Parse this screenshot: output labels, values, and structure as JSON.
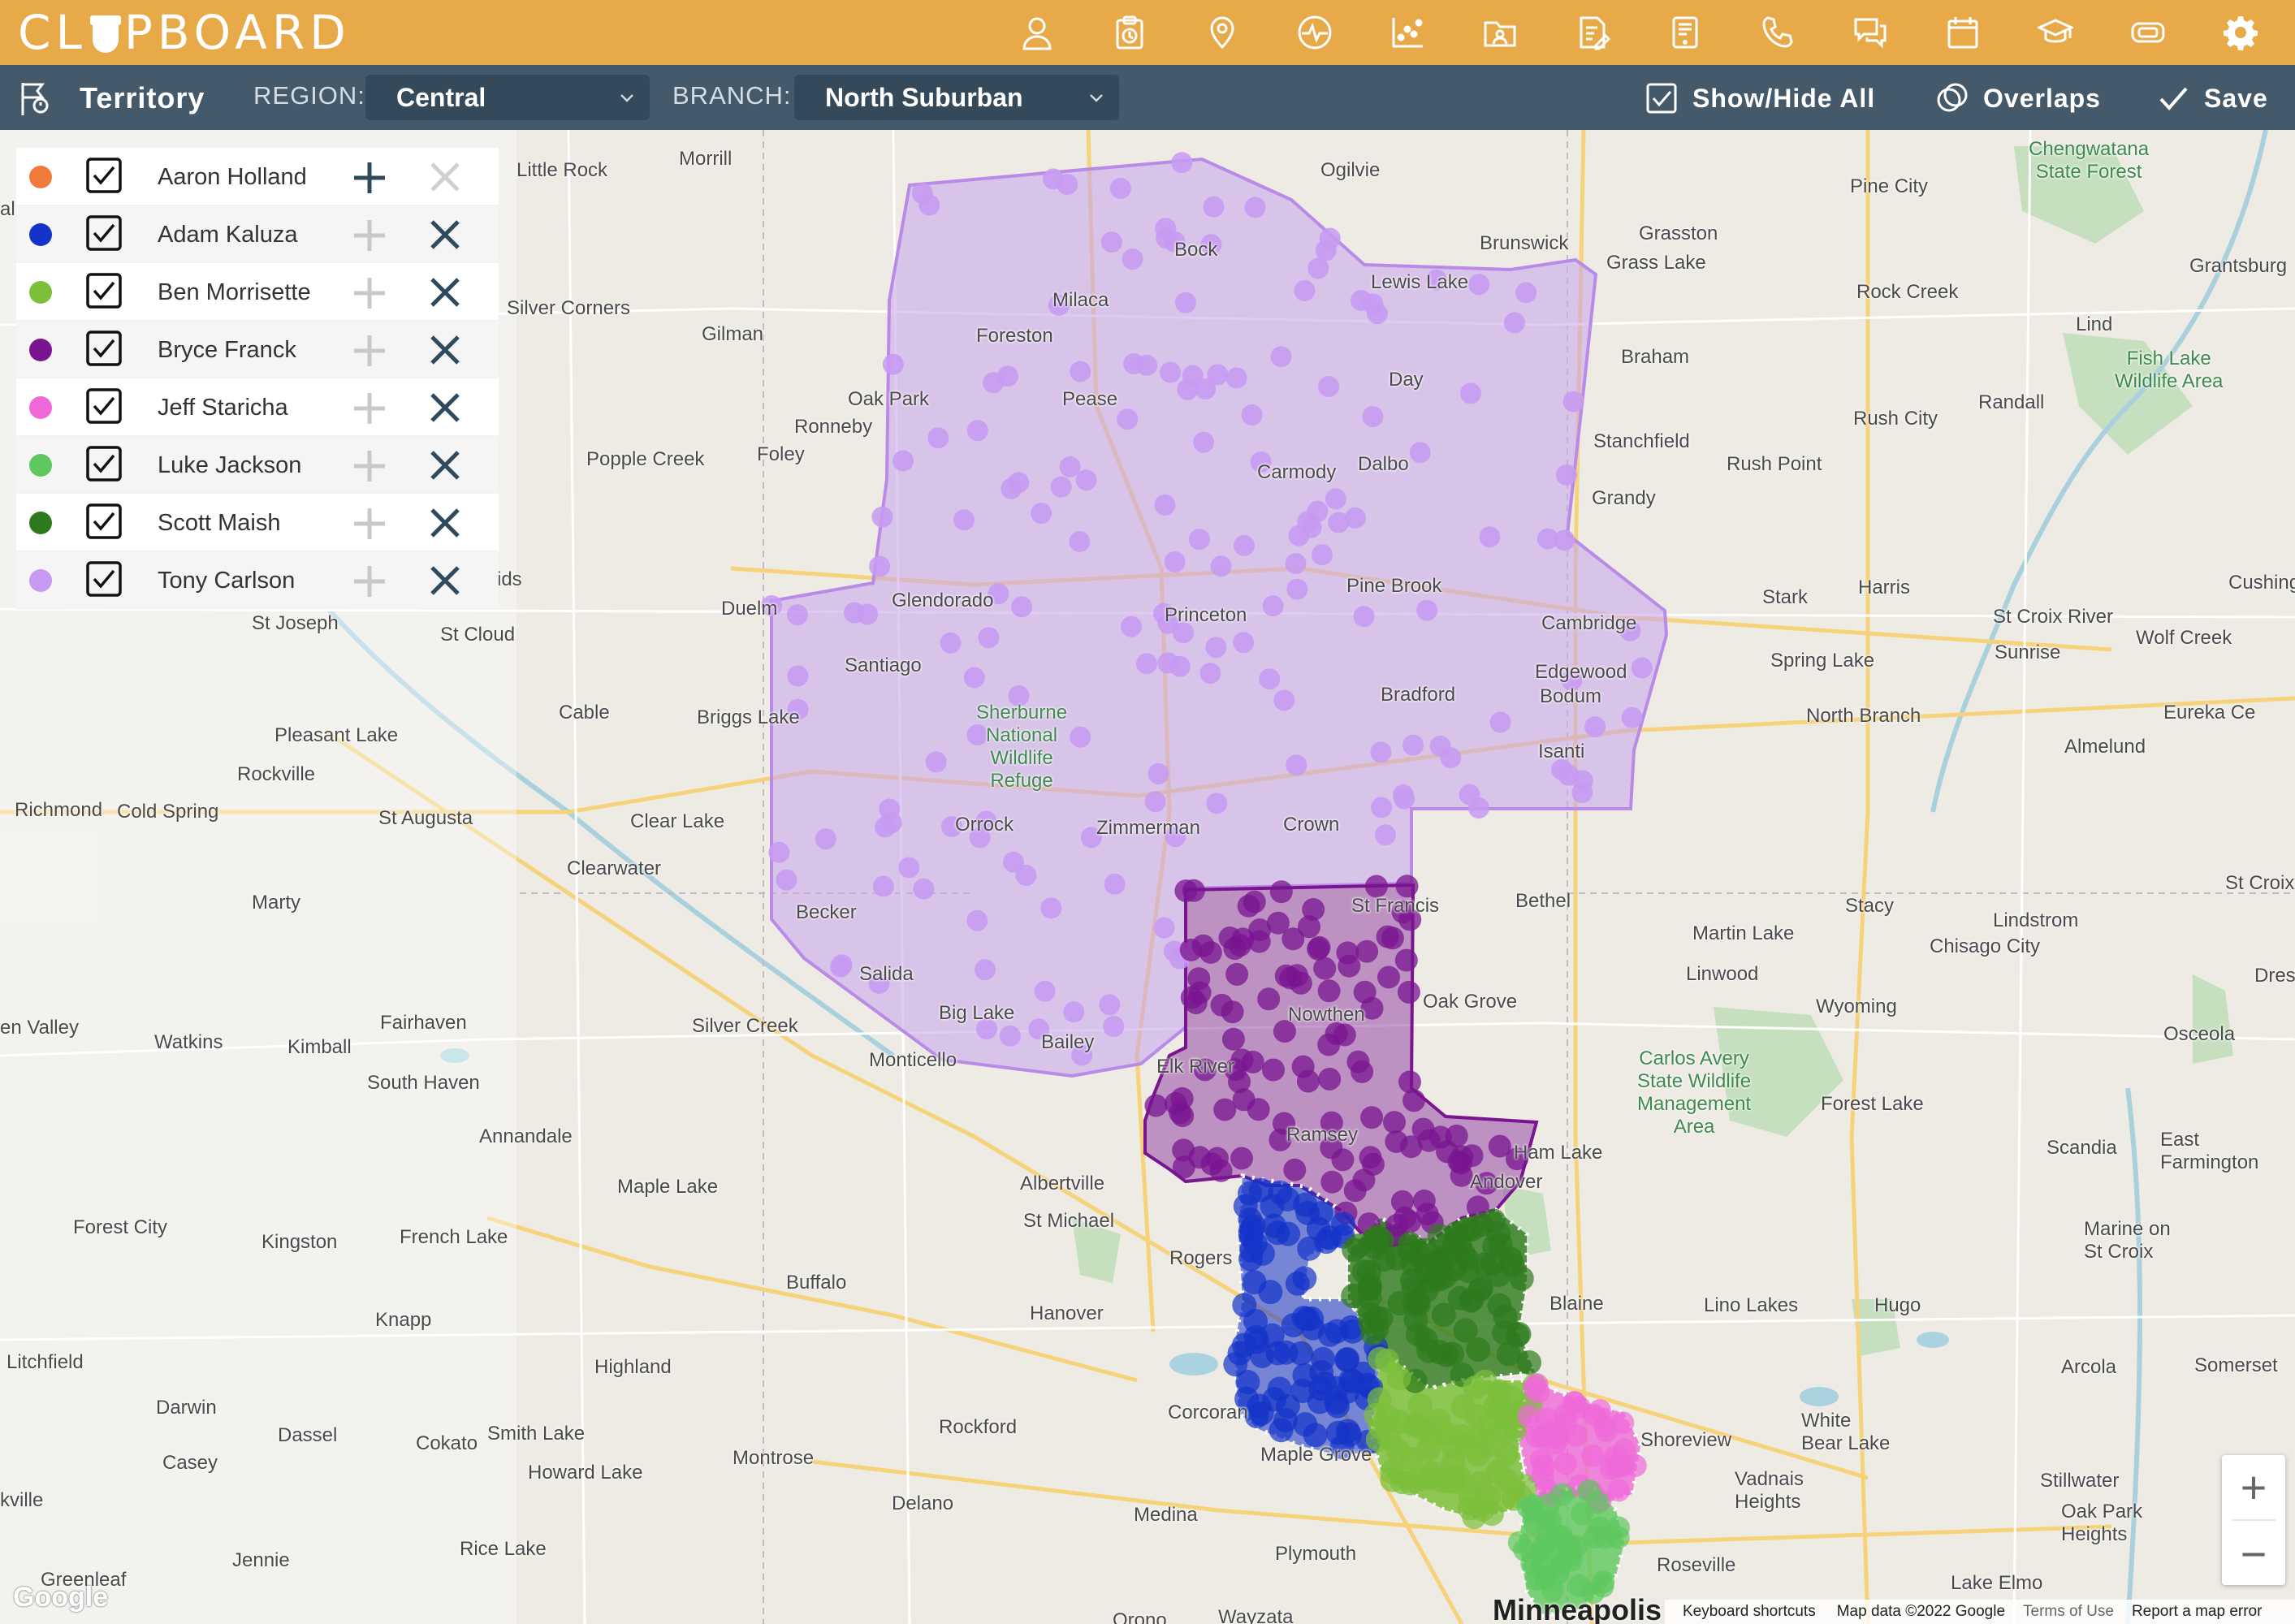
{
  "app": {
    "logo_left": "CL",
    "logo_right": "PBOARD",
    "brand_color": "#e8a948",
    "toolbar_color": "#44596a"
  },
  "top_icons": [
    "user-icon",
    "clipboard-clock-icon",
    "map-pin-icon",
    "pulse-icon",
    "scatter-chart-icon",
    "folder-user-icon",
    "document-edit-icon",
    "tablet-icon",
    "phone-icon",
    "chat-icon",
    "calendar-icon",
    "graduation-cap-icon",
    "ticket-icon",
    "gear-icon"
  ],
  "toolbar": {
    "title": "Territory",
    "region_label": "REGION:",
    "region_value": "Central",
    "branch_label": "BRANCH:",
    "branch_value": "North Suburban",
    "show_hide": "Show/Hide All",
    "overlaps": "Overlaps",
    "save": "Save"
  },
  "legend": [
    {
      "name": "Aaron Holland",
      "color": "#f07a3a",
      "checked": true,
      "plus_active": true,
      "x_active": false
    },
    {
      "name": "Adam Kaluza",
      "color": "#1433c8",
      "checked": true,
      "plus_active": false,
      "x_active": true
    },
    {
      "name": "Ben Morrisette",
      "color": "#7cbf3a",
      "checked": true,
      "plus_active": false,
      "x_active": true
    },
    {
      "name": "Bryce Franck",
      "color": "#7a1490",
      "checked": true,
      "plus_active": false,
      "x_active": true
    },
    {
      "name": "Jeff Staricha",
      "color": "#ef6ad8",
      "checked": true,
      "plus_active": false,
      "x_active": true
    },
    {
      "name": "Luke Jackson",
      "color": "#5ec85e",
      "checked": true,
      "plus_active": false,
      "x_active": true
    },
    {
      "name": "Scott Maish",
      "color": "#2e7a1c",
      "checked": true,
      "plus_active": false,
      "x_active": true
    },
    {
      "name": "Tony Carlson",
      "color": "#c79af2",
      "checked": true,
      "plus_active": false,
      "x_active": true
    }
  ],
  "map_labels": {
    "little_rock": "Little Rock",
    "morrill": "Morrill",
    "ogilvie": "Ogilvie",
    "pine_city": "Pine City",
    "chengwatana": "Chengwatana",
    "state_forest": "State Forest",
    "brunswick": "Brunswick",
    "grasston": "Grasston",
    "grass_lake": "Grass Lake",
    "lewis_lake": "Lewis Lake",
    "bock": "Bock",
    "rock_creek": "Rock Creek",
    "grantsburg": "Grantsburg",
    "milaca": "Milaca",
    "silver_corners": "Silver Corners",
    "gilman": "Gilman",
    "foreston": "Foreston",
    "braham": "Braham",
    "lind": "Lind",
    "fish_lake": "Fish Lake",
    "wildlife_area": "Wildlife Area",
    "day": "Day",
    "pease": "Pease",
    "oak_park": "Oak Park",
    "ronneby": "Ronneby",
    "randall": "Randall",
    "rush_city": "Rush City",
    "stanchfield": "Stanchfield",
    "popple_creek": "Popple Creek",
    "foley": "Foley",
    "carmody": "Carmody",
    "dalbo": "Dalbo",
    "rush_point": "Rush Point",
    "grandy": "Grandy",
    "pine_brook": "Pine Brook",
    "stark": "Stark",
    "harris": "Harris",
    "cushing": "Cushing",
    "glendorado": "Glendorado",
    "princeton": "Princeton",
    "cambridge": "Cambridge",
    "st_joseph": "St Joseph",
    "st_cloud": "St Cloud",
    "duelm": "Duelm",
    "santiago": "Santiago",
    "st_croix_river": "St Croix River",
    "sunrise": "Sunrise",
    "wolf_creek": "Wolf Creek",
    "spring_lake": "Spring Lake",
    "edgewood": "Edgewood",
    "bodum": "Bodum",
    "cable": "Cable",
    "briggs_lake": "Briggs Lake",
    "sherburne_national": "Sherburne",
    "sherburne_national2": "National",
    "sherburne_wildlife": "Wildlife",
    "sherburne_refuge": "Refuge",
    "bradford": "Bradford",
    "north_branch": "North Branch",
    "eureka": "Eureka Ce",
    "pleasant_lake": "Pleasant Lake",
    "isanti": "Isanti",
    "almelund": "Almelund",
    "rockville": "Rockville",
    "richmond": "Richmond",
    "cold_spring": "Cold Spring",
    "st_augusta": "St Augusta",
    "clear_lake": "Clear Lake",
    "orrock": "Orrock",
    "zimmerman": "Zimmerman",
    "crown": "Crown",
    "clearwater": "Clearwater",
    "marty": "Marty",
    "st_francis": "St Francis",
    "bethel": "Bethel",
    "stacy": "Stacy",
    "st_croix": "St Croix",
    "lindstrom": "Lindstrom",
    "becker": "Becker",
    "martin_lake": "Martin Lake",
    "chisago_city": "Chisago City",
    "linwood": "Linwood",
    "dres": "Dres",
    "salida": "Salida",
    "nowthen": "Nowthen",
    "oak_grove": "Oak Grove",
    "wyoming": "Wyoming",
    "den_valley": "en Valley",
    "silver_creek": "Silver Creek",
    "big_lake": "Big Lake",
    "osceola": "Osceola",
    "watkins": "Watkins",
    "kimball": "Kimball",
    "fairhaven": "Fairhaven",
    "monticello": "Monticello",
    "bailey": "Bailey",
    "carlos_1": "Carlos Avery",
    "carlos_2": "State Wildlife",
    "carlos_3": "Management",
    "carlos_4": "Area",
    "south_haven": "South Haven",
    "elk_river": "Elk River",
    "forest_lake": "Forest Lake",
    "annandale": "Annandale",
    "ramsey": "Ramsey",
    "ham_lake": "Ham Lake",
    "scandia": "Scandia",
    "east_farmington_1": "East",
    "east_farmington_2": "Farmington",
    "maple_lake": "Maple Lake",
    "albertville": "Albertville",
    "andover": "Andover",
    "st_michael": "St Michael",
    "forest_city": "Forest City",
    "marine_1": "Marine on",
    "marine_2": "St Croix",
    "rogers": "Rogers",
    "kingston": "Kingston",
    "french_lake": "French Lake",
    "buffalo": "Buffalo",
    "blaine": "Blaine",
    "lino_lakes": "Lino Lakes",
    "hugo": "Hugo",
    "knapp": "Knapp",
    "hanover": "Hanover",
    "litchfield": "Litchfield",
    "highland": "Highland",
    "arcola": "Arcola",
    "somerset": "Somerset",
    "darwin": "Darwin",
    "corcoran": "Corcoran",
    "white_bear_1": "White",
    "white_bear_2": "Bear Lake",
    "rockford": "Rockford",
    "dassel": "Dassel",
    "smith_lake": "Smith Lake",
    "cokato": "Cokato",
    "maple_grove": "Maple Grove",
    "shoreview": "Shoreview",
    "casey": "Casey",
    "howard_lake": "Howard Lake",
    "montrose": "Montrose",
    "stillwater": "Stillwater",
    "vadnais_1": "Vadnais",
    "vadnais_2": "Heights",
    "delano": "Delano",
    "kville": "kville",
    "medina": "Medina",
    "oak_park2": "Oak Park",
    "oak_heights": "Heights",
    "rice_lake": "Rice Lake",
    "jennie": "Jennie",
    "plymouth": "Plymouth",
    "roseville": "Roseville",
    "greenleaf": "Greenleaf",
    "lake_elmo": "Lake Elmo",
    "minneapolis": "Minneapolis",
    "wayzata": "Wayzata",
    "orono": "Orono",
    "ids": "ids",
    "al": "al"
  },
  "map_footer": {
    "google": "Google",
    "keyboard": "Keyboard shortcuts",
    "map_data": "Map data ©2022 Google",
    "terms": "Terms of Use",
    "report": "Report a map error"
  },
  "zoom": {
    "in": "+",
    "out": "−"
  }
}
